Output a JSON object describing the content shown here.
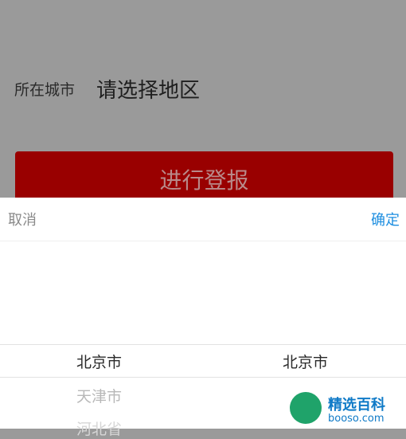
{
  "form": {
    "city_label": "所在城市",
    "city_value": "请选择地区",
    "submit_label": "进行登报"
  },
  "picker": {
    "cancel_label": "取消",
    "confirm_label": "确定",
    "province_column": [
      "北京市",
      "天津市",
      "河北省"
    ],
    "city_column": [
      "北京市"
    ]
  },
  "watermark": {
    "text": "精选百科",
    "url": "booso.com"
  },
  "colors": {
    "overlay_gray": "#9a9a9a",
    "button_red": "#990000",
    "confirm_blue": "#1d8ee0"
  }
}
